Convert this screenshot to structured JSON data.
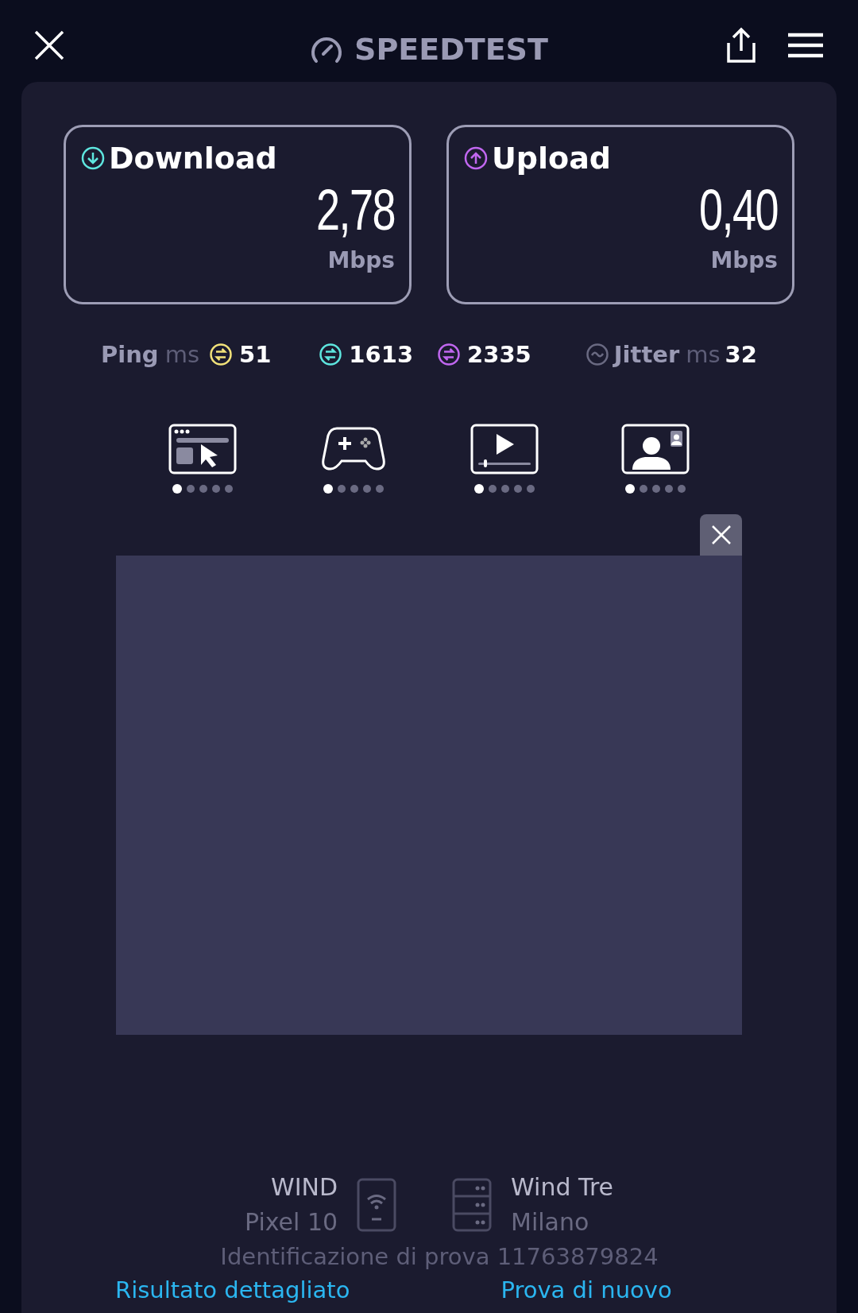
{
  "header": {
    "title": "SPEEDTEST"
  },
  "results": [
    {
      "kind": "download",
      "label": "Download",
      "value": "2,78",
      "unit": "Mbps",
      "color": "#5ee6df"
    },
    {
      "kind": "upload",
      "label": "Upload",
      "value": "0,40",
      "unit": "Mbps",
      "color": "#c167f0"
    }
  ],
  "ping": {
    "label": "Ping",
    "unit": "ms",
    "values": [
      {
        "value": "51",
        "color": "#f2e27a"
      },
      {
        "value": "1613",
        "color": "#5ee6df"
      },
      {
        "value": "2335",
        "color": "#c167f0"
      }
    ]
  },
  "jitter": {
    "label": "Jitter",
    "unit": "ms",
    "value": "32"
  },
  "experiences": [
    {
      "kind": "browsing",
      "dots": [
        {
          "filled": true
        },
        {
          "filled": false
        },
        {
          "filled": false
        },
        {
          "filled": false
        },
        {
          "filled": false
        }
      ]
    },
    {
      "kind": "gaming",
      "dots": [
        {
          "filled": true
        },
        {
          "filled": false
        },
        {
          "filled": false
        },
        {
          "filled": false
        },
        {
          "filled": false
        }
      ]
    },
    {
      "kind": "video",
      "dots": [
        {
          "filled": true
        },
        {
          "filled": false
        },
        {
          "filled": false
        },
        {
          "filled": false
        },
        {
          "filled": false
        }
      ]
    },
    {
      "kind": "video_call",
      "dots": [
        {
          "filled": true
        },
        {
          "filled": false
        },
        {
          "filled": false
        },
        {
          "filled": false
        },
        {
          "filled": false
        }
      ]
    }
  ],
  "provider": {
    "name": "WIND",
    "device": "Pixel 10"
  },
  "server": {
    "name": "Wind Tre",
    "city": "Milano"
  },
  "test_id": "Identificazione di prova 11763879824",
  "links": [
    "Risultato dettagliato",
    "Prova di nuovo"
  ]
}
